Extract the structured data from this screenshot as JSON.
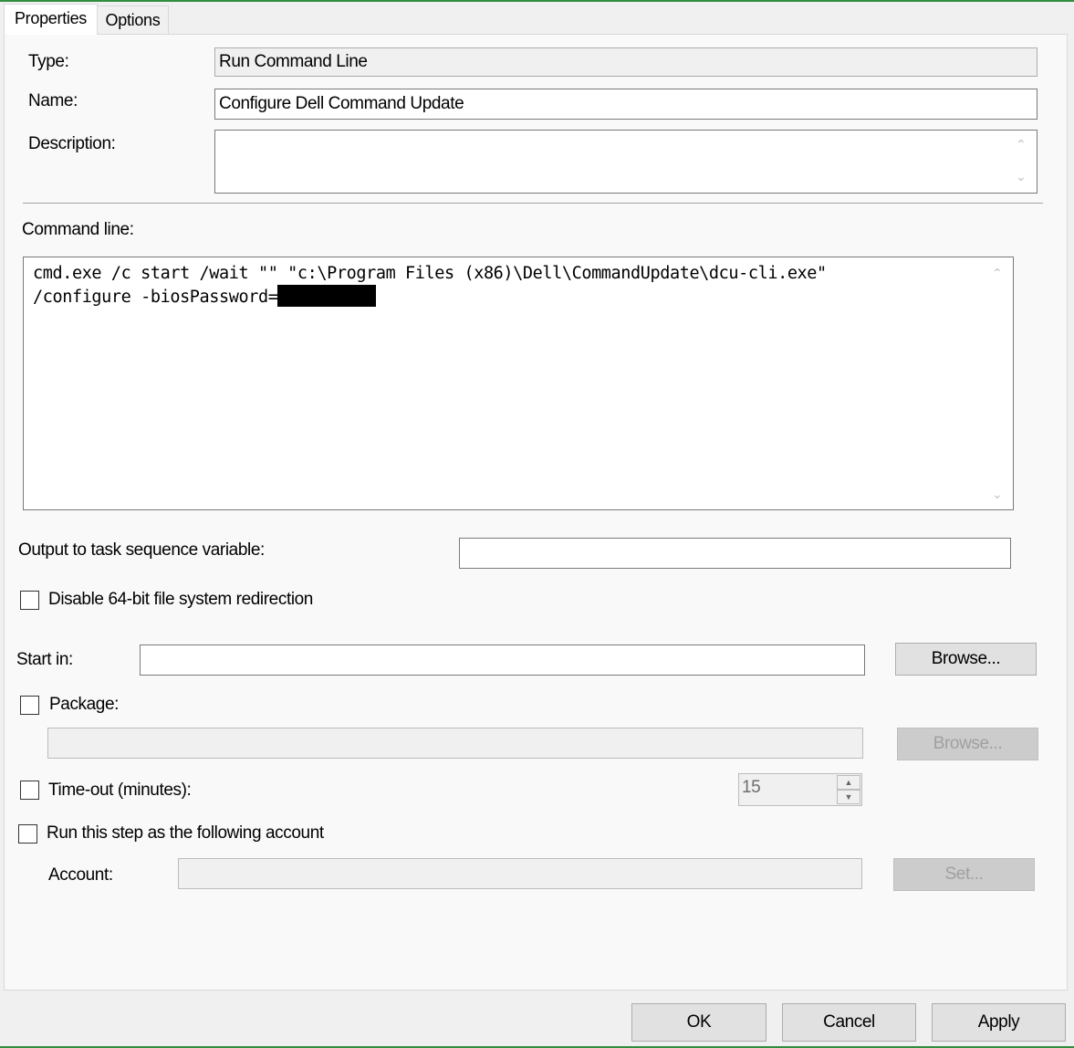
{
  "tabs": [
    {
      "label": "Properties",
      "active": true
    },
    {
      "label": "Options",
      "active": false
    }
  ],
  "form": {
    "type_label": "Type:",
    "type_value": "Run Command Line",
    "name_label": "Name:",
    "name_value": "Configure Dell Command Update",
    "description_label": "Description:",
    "description_value": "",
    "command_line_label": "Command line:",
    "command_line_lines": [
      "cmd.exe /c start /wait \"\" \"c:\\Program Files (x86)\\Dell\\CommandUpdate\\dcu-cli.exe\"",
      "/configure -biosPassword="
    ],
    "output_variable_label": "Output to task sequence variable:",
    "output_variable_value": "",
    "disable_redirection_label": "Disable 64-bit file system redirection",
    "disable_redirection_checked": false,
    "start_in_label": "Start in:",
    "start_in_value": "",
    "browse_label": "Browse...",
    "package_label": "Package:",
    "package_checked": false,
    "package_value": "",
    "package_browse_label": "Browse...",
    "timeout_label": "Time-out (minutes):",
    "timeout_checked": false,
    "timeout_value": "15",
    "run_as_label": "Run this step as the following account",
    "run_as_checked": false,
    "account_label": "Account:",
    "account_value": "",
    "set_label": "Set..."
  },
  "footer": {
    "ok_label": "OK",
    "cancel_label": "Cancel",
    "apply_label": "Apply"
  },
  "colors": {
    "window_accent": "#2f8f3f",
    "redaction": "#000000"
  }
}
